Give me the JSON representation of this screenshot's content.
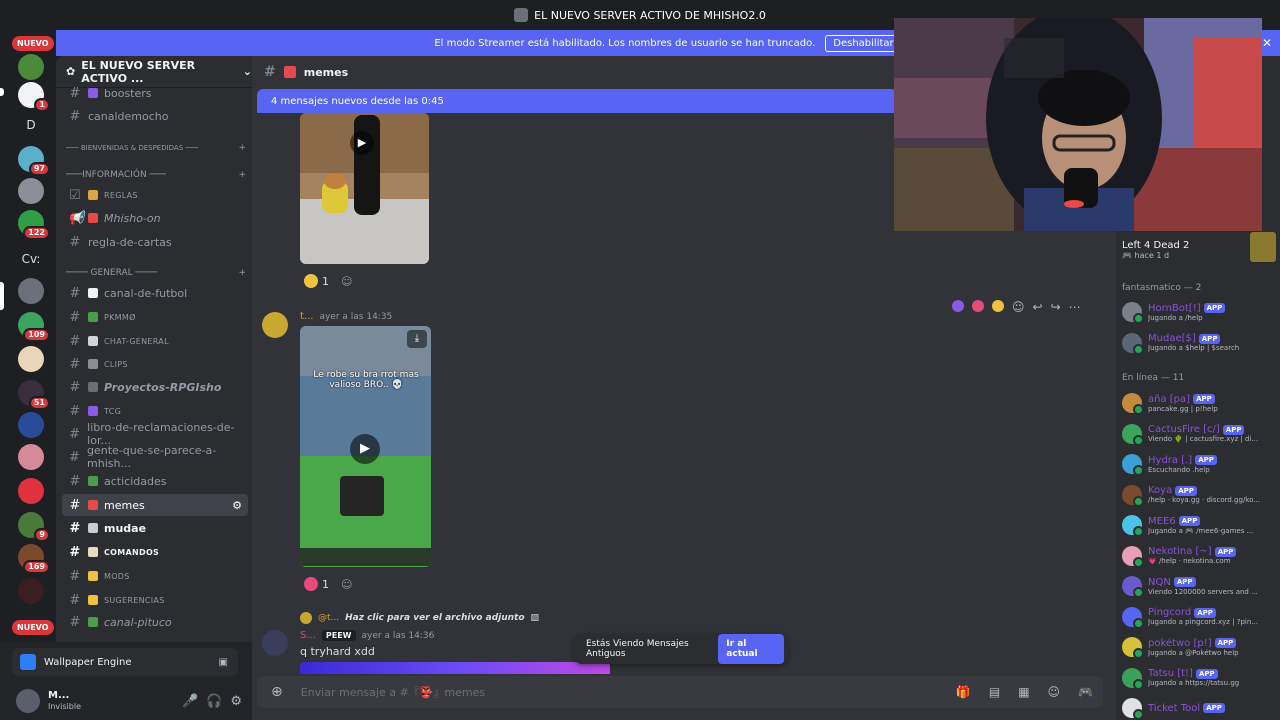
{
  "window": {
    "title": "EL NUEVO SERVER ACTIVO DE MHISHO2.0"
  },
  "streamer_banner": {
    "text": "El modo Streamer está habilitado. Los nombres de usuario se han truncado.",
    "button": "Deshabilitar"
  },
  "guilds": {
    "nuevo_top": "NUEVO",
    "nuevo_bottom": "NUEVO",
    "letters": [
      "D",
      "Cv:"
    ],
    "badges": [
      "1",
      "97",
      "122",
      "109",
      "51",
      "9",
      "169"
    ]
  },
  "server": {
    "name": "EL NUEVO SERVER ACTIVO ..."
  },
  "channels": {
    "boosters": "boosters",
    "canaldemocho": "canaldemocho",
    "cat_bienvenidas": "─── BIENVENIDAS & DESPEDIDAS ───",
    "cat_info": "───INFORMACIÓN ───",
    "reglas": "REGLAS",
    "mhisho_on": "Mhisho-on",
    "regla_cartas": "regla-de-cartas",
    "cat_general": "──── GENERAL ────",
    "futbol": "canal-de-futbol",
    "pkmmo": "PKMMØ",
    "chat_general": "CHAT-GENERAL",
    "clips": "CLIPS",
    "proyectos": "Proyectos-RPGIsho",
    "tcg": "TCG",
    "libro": "libro-de-reclamaciones-de-lor...",
    "gente": "gente-que-se-parece-a-mhish...",
    "acticidades": "acticidades",
    "memes": "memes",
    "mudae": "mudae",
    "comandos": "COMANDOS",
    "mods": "MODS",
    "sugerencias": "SUGERENCIAS",
    "pituco": "canal-pituco"
  },
  "user_panel": {
    "app": "Wallpaper Engine",
    "name": "M...",
    "status": "Invisible"
  },
  "chat": {
    "channel_name": "memes",
    "new_messages": "4 mensajes nuevos desde las 0:45",
    "reaction1_count": "1",
    "msg2_author": "t...",
    "msg2_time": "ayer a las 14:35",
    "video_caption": "Le robe su bra rrot mas valioso BRO.. 💀",
    "reaction2_count": "1",
    "reply_author": "@t...",
    "reply_text": "Haz clic para ver el archivo adjunto",
    "msg3_author": "S...",
    "msg3_tag": "PEEW",
    "msg3_time": "ayer a las 14:36",
    "msg3_text": "q tryhard xdd",
    "old_msgs_text": "Estás Viendo Mensajes Antiguos",
    "old_msgs_button": "Ir al actual",
    "composer_placeholder": "Enviar mensaje a #『👺』memes"
  },
  "members": {
    "activity_title": "Left 4 Dead 2",
    "activity_time": "hace 1 d",
    "group1": "fantasmatico — 2",
    "group2": "En línea — 11",
    "app_tag": "APP",
    "list1": [
      {
        "name": "HornBot[!]",
        "status": "Jugando a /help",
        "color": "#7b7f88"
      },
      {
        "name": "Mudae[$]",
        "status": "Jugando a $help | $search",
        "color": "#5a6578"
      }
    ],
    "list2": [
      {
        "name": "aña [pa]",
        "status": "pancake.gg | p!help",
        "color": "#c58b3c"
      },
      {
        "name": "CactusFire [c/]",
        "status": "Viendo 🌵 | cactusfire.xyz | di...",
        "color": "#3ba55d"
      },
      {
        "name": "Hydra [.]",
        "status": "Escuchando .help",
        "color": "#3aa0d6"
      },
      {
        "name": "Koya",
        "status": "/help · koya.gg · discord.gg/ko...",
        "color": "#7a4b2f"
      },
      {
        "name": "MEE6",
        "status": "Jugando a 🎮 /mee6-games ...",
        "color": "#4ac3e6"
      },
      {
        "name": "Nekotina [~]",
        "status": "💗 /help · nekotina.com",
        "color": "#e8a0b6"
      },
      {
        "name": "NQN",
        "status": "Viendo 1200000 servers and ...",
        "color": "#6a5acd"
      },
      {
        "name": "Pingcord",
        "status": "Jugando a pingcord.xyz | ?pin...",
        "color": "#5865f2"
      },
      {
        "name": "pokétwo [p!]",
        "status": "Jugando a @Pokétwo help",
        "color": "#d4c23a"
      },
      {
        "name": "Tatsu [t!]",
        "status": "Jugando a https://tatsu.gg",
        "color": "#3aa15a"
      },
      {
        "name": "Ticket Tool",
        "status": "",
        "color": "#e1e1e1"
      }
    ]
  }
}
